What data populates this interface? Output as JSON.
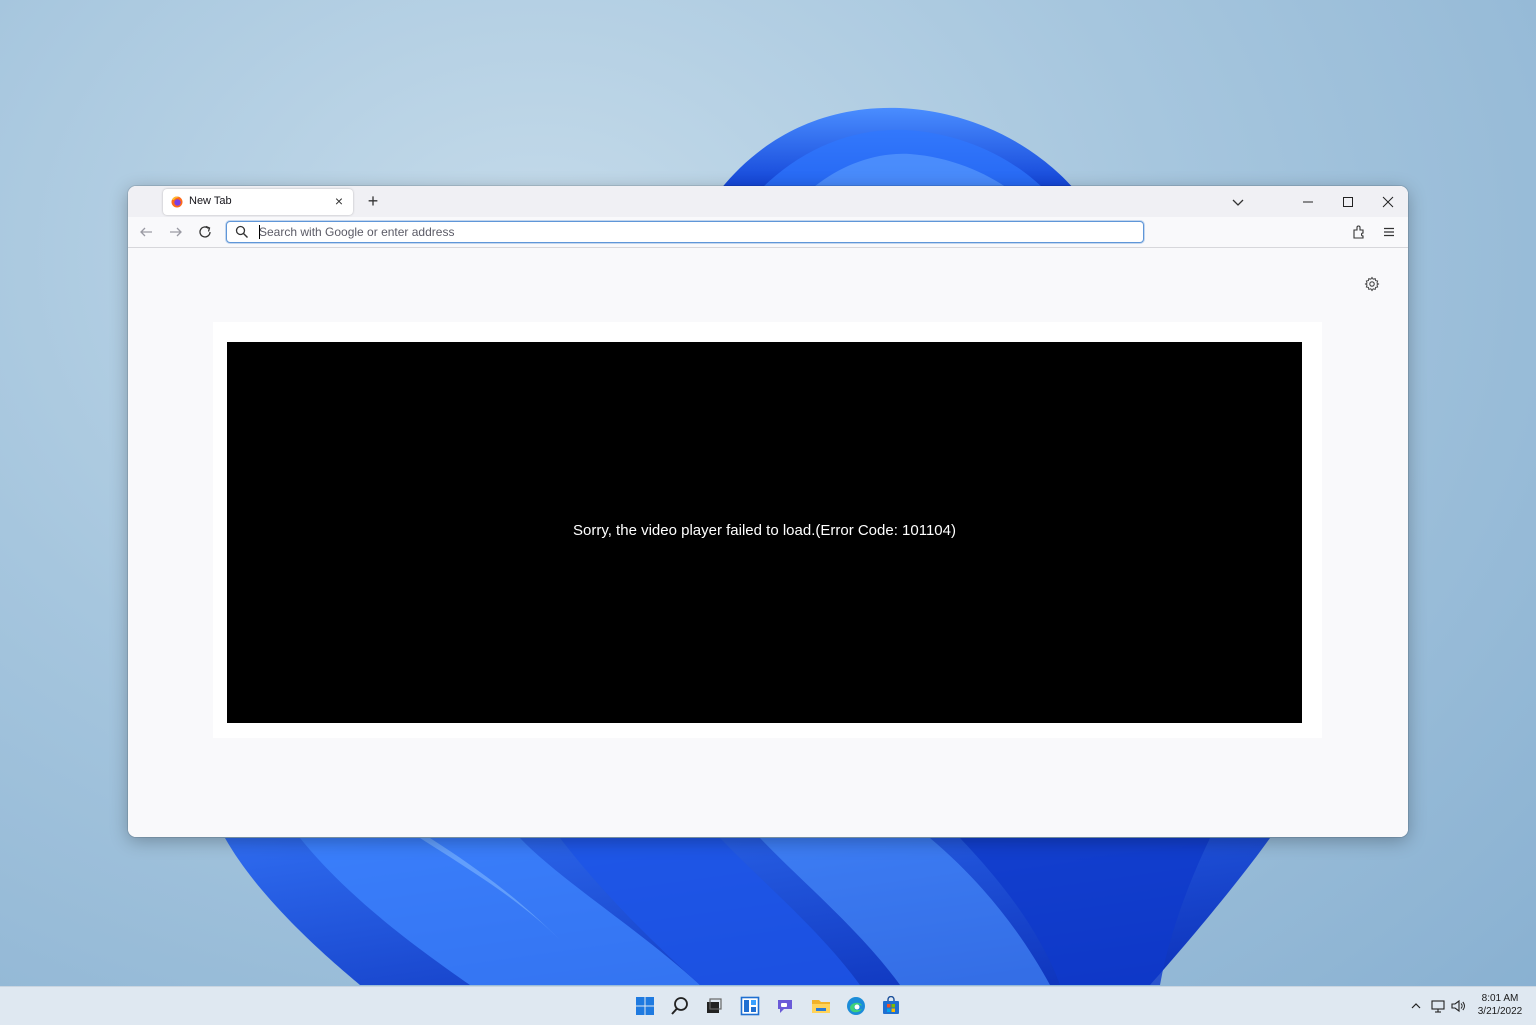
{
  "browser": {
    "tab": {
      "title": "New Tab",
      "close_label": "×",
      "favicon": "firefox-icon"
    },
    "new_tab_label": "+",
    "tabs_list_icon": "chevron-down-icon",
    "window_controls": [
      "minimize-icon",
      "maximize-icon",
      "close-icon"
    ],
    "nav": {
      "back_icon": "back-arrow-icon",
      "forward_icon": "forward-arrow-icon",
      "reload_icon": "reload-icon"
    },
    "urlbar": {
      "value": "",
      "placeholder": "Search with Google or enter address",
      "search_icon": "search-icon"
    },
    "toolbar_right": [
      "extensions-icon",
      "menu-icon"
    ],
    "content": {
      "settings_icon": "gear-icon",
      "video_error": "Sorry, the video player failed to load.(Error Code: 101104)"
    }
  },
  "taskbar": {
    "apps": [
      "start-icon",
      "search-icon",
      "task-view-icon",
      "widgets-icon",
      "teams-chat-icon",
      "file-explorer-icon",
      "edge-icon",
      "store-icon"
    ],
    "tray": [
      "chevron-up-icon",
      "network-icon",
      "volume-icon"
    ],
    "clock": {
      "time": "8:01 AM",
      "date": "3/21/2022"
    }
  },
  "colors": {
    "accent": "#0060df",
    "urlbar_border": "#5f96d8",
    "player_bg": "#000000",
    "page_bg": "#f9f9fb",
    "taskbar_bg": "#dfe8f1"
  }
}
